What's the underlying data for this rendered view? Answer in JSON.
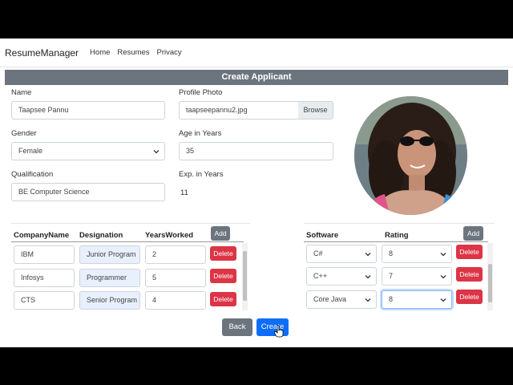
{
  "navbar": {
    "brand": "ResumeManager",
    "links": [
      "Home",
      "Resumes",
      "Privacy"
    ]
  },
  "form": {
    "title": "Create Applicant",
    "name_label": "Name",
    "name_value": "Taapsee Pannu",
    "photo_label": "Profile Photo",
    "photo_value": "taapseepannu2.jpg",
    "browse_label": "Browse",
    "gender_label": "Gender",
    "gender_value": "Female",
    "age_label": "Age in Years",
    "age_value": "35",
    "qualification_label": "Qualification",
    "qualification_value": "BE Computer Science",
    "exp_label": "Exp. in Years",
    "exp_value": "11"
  },
  "experience": {
    "headers": [
      "CompanyName",
      "Designation",
      "YearsWorked"
    ],
    "add_label": "Add",
    "delete_label": "Delete",
    "rows": [
      {
        "company": "IBM",
        "designation": "Junior Program",
        "years": "2"
      },
      {
        "company": "Infosys",
        "designation": "Programmer",
        "years": "5"
      },
      {
        "company": "CTS",
        "designation": "Senior Program",
        "years": "4"
      }
    ]
  },
  "skills": {
    "headers": [
      "Software",
      "Rating"
    ],
    "add_label": "Add",
    "delete_label": "Delete",
    "rows": [
      {
        "software": "C#",
        "rating": "8"
      },
      {
        "software": "C++",
        "rating": "7"
      },
      {
        "software": "Core Java",
        "rating": "8"
      }
    ]
  },
  "actions": {
    "back_label": "Back",
    "create_label": "Create"
  },
  "colors": {
    "header_bg": "#6c757d",
    "delete_btn": "#dc3545",
    "create_btn": "#0d6efd",
    "secondary_btn": "#6c757d"
  }
}
